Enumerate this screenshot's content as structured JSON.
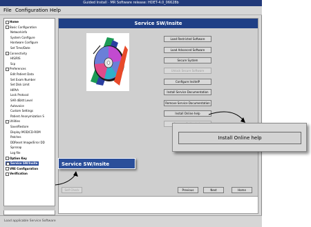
{
  "window": {
    "title": "Guided Install · MR Software release: HDET-4.0_06628b"
  },
  "menubar": {
    "items": [
      "File",
      "Configuration",
      "Help"
    ]
  },
  "tree": {
    "items": [
      {
        "label": "Home",
        "level": "top"
      },
      {
        "label": "Basic Configuration",
        "level": "group"
      },
      {
        "label": "Networkinfo",
        "level": "child"
      },
      {
        "label": "System Configure",
        "level": "child"
      },
      {
        "label": "Hardware Configure",
        "level": "child"
      },
      {
        "label": "Set Time/Date",
        "level": "child"
      },
      {
        "label": "Connectivity",
        "level": "group"
      },
      {
        "label": "HIS/RIS",
        "level": "child"
      },
      {
        "label": "Scp",
        "level": "child"
      },
      {
        "label": "Preferences",
        "level": "group"
      },
      {
        "label": "Edit Patient Data",
        "level": "child"
      },
      {
        "label": "Set Exam Number",
        "level": "child"
      },
      {
        "label": "Set Disk Limit",
        "level": "child"
      },
      {
        "label": "HIPAA",
        "level": "child"
      },
      {
        "label": "Lock Protocol",
        "level": "child"
      },
      {
        "label": "SAR dB/dt Level",
        "level": "child"
      },
      {
        "label": "Autovoice",
        "level": "child"
      },
      {
        "label": "Custom Settings",
        "level": "child"
      },
      {
        "label": "Patient Anonymization S",
        "level": "child"
      },
      {
        "label": "Utilities",
        "level": "group"
      },
      {
        "label": "Save/Restore",
        "level": "child"
      },
      {
        "label": "Display MOD/CD-ROM",
        "level": "child"
      },
      {
        "label": "Patches",
        "level": "child"
      },
      {
        "label": "DDReset Image/Error DD",
        "level": "child"
      },
      {
        "label": "Sprsnap",
        "level": "child"
      },
      {
        "label": "Log file",
        "level": "child"
      },
      {
        "label": "Option Key",
        "level": "top"
      },
      {
        "label": "Service SW/Insite",
        "level": "top",
        "selected": true
      },
      {
        "label": "VRE Configuration",
        "level": "top"
      },
      {
        "label": "Verification",
        "level": "top"
      }
    ]
  },
  "panel": {
    "title": "Service SW/Insite",
    "buttons": [
      {
        "label": "Load Restricted Software",
        "enabled": true
      },
      {
        "label": "Load Advanced Software",
        "enabled": true
      },
      {
        "label": "Secure System",
        "enabled": true
      },
      {
        "label": "Unlock Secure Software",
        "enabled": false
      },
      {
        "label": "Configure InsiteIP",
        "enabled": true
      },
      {
        "label": "Install Service Documentation",
        "enabled": true
      },
      {
        "label": "Remove Service Documentation",
        "enabled": true
      },
      {
        "label": "Install Online help",
        "enabled": true
      },
      {
        "label": "Remove Online help",
        "enabled": false
      }
    ]
  },
  "nav": {
    "left_label": "Self Check",
    "previous_label": "Previous",
    "next_label": "Next",
    "home_label": "Home"
  },
  "status": {
    "text": "Load applicable Service Software"
  },
  "callouts": {
    "left_title": "Service SW/Insite",
    "right_button": "Install Online help"
  },
  "colors": {
    "title_blue": "#1f3f86",
    "selection_blue": "#2a4a9a",
    "window_gray": "#d6d6d6"
  }
}
